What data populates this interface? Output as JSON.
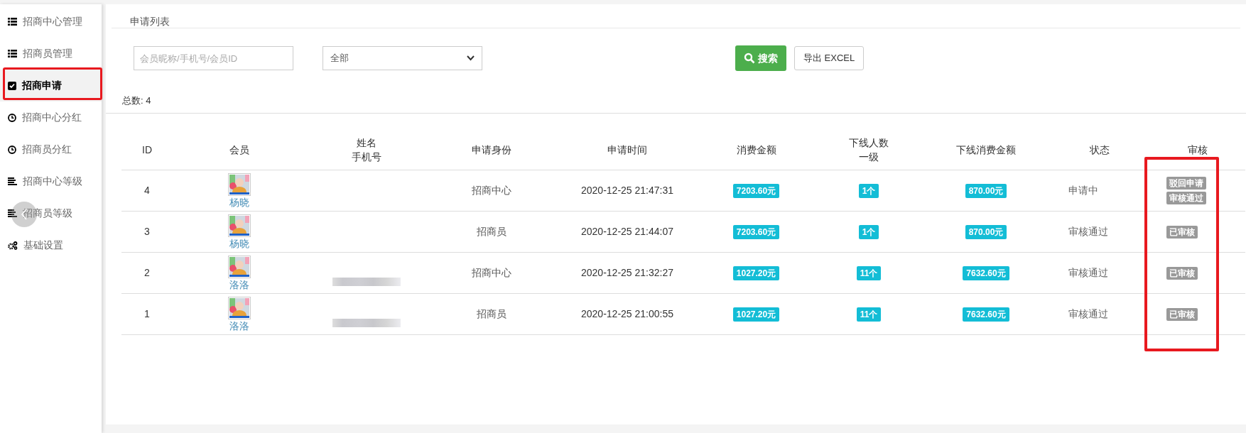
{
  "sidebar": {
    "items": [
      {
        "label": "招商中心管理",
        "kind": "list",
        "selected": false,
        "highlighted": false
      },
      {
        "label": "招商员管理",
        "kind": "list",
        "selected": false,
        "highlighted": false
      },
      {
        "label": "招商申请",
        "kind": "check",
        "selected": true,
        "highlighted": true
      },
      {
        "label": "招商中心分红",
        "kind": "clock",
        "selected": false,
        "highlighted": false
      },
      {
        "label": "招商员分红",
        "kind": "clock",
        "selected": false,
        "highlighted": false
      },
      {
        "label": "招商中心等级",
        "kind": "bars",
        "selected": false,
        "highlighted": false
      },
      {
        "label": "招商员等级",
        "kind": "bars",
        "selected": false,
        "highlighted": false
      },
      {
        "label": "基础设置",
        "kind": "gears",
        "selected": false,
        "highlighted": false
      }
    ]
  },
  "panel": {
    "title": "申请列表"
  },
  "filters": {
    "search": {
      "placeholder": "会员昵称/手机号/会员ID"
    },
    "select": {
      "value": "全部"
    },
    "search_button": "搜索",
    "export_button": "导出 EXCEL"
  },
  "total": {
    "label": "总数:",
    "value": "4"
  },
  "table": {
    "columns": [
      {
        "lines": [
          "ID"
        ]
      },
      {
        "lines": [
          "会员"
        ]
      },
      {
        "lines": [
          "姓名",
          "手机号"
        ]
      },
      {
        "lines": [
          "申请身份"
        ]
      },
      {
        "lines": [
          "申请时间"
        ]
      },
      {
        "lines": [
          "消费金额"
        ]
      },
      {
        "lines": [
          "下线人数",
          "一级"
        ]
      },
      {
        "lines": [
          "下线消费金额"
        ]
      },
      {
        "lines": [
          "状态"
        ]
      },
      {
        "lines": [
          "审核"
        ],
        "highlighted": true
      }
    ],
    "rows": [
      {
        "id": "4",
        "member": "杨晓",
        "phone_redacted": false,
        "role": "招商中心",
        "time": "2020-12-25 21:47:31",
        "amount": "7203.60元",
        "count": "1个",
        "downline_amount": "870.00元",
        "status": "申请中",
        "actions": [
          "驳回申请",
          "审核通过"
        ]
      },
      {
        "id": "3",
        "member": "杨晓",
        "phone_redacted": false,
        "role": "招商员",
        "time": "2020-12-25 21:44:07",
        "amount": "7203.60元",
        "count": "1个",
        "downline_amount": "870.00元",
        "status": "审核通过",
        "actions": [
          "已审核"
        ]
      },
      {
        "id": "2",
        "member": "洛洛",
        "phone_redacted": true,
        "role": "招商中心",
        "time": "2020-12-25 21:32:27",
        "amount": "1027.20元",
        "count": "11个",
        "downline_amount": "7632.60元",
        "status": "审核通过",
        "actions": [
          "已审核"
        ]
      },
      {
        "id": "1",
        "member": "洛洛",
        "phone_redacted": true,
        "role": "招商员",
        "time": "2020-12-25 21:00:55",
        "amount": "1027.20元",
        "count": "11个",
        "downline_amount": "7632.60元",
        "status": "审核通过",
        "actions": [
          "已审核"
        ]
      }
    ]
  }
}
